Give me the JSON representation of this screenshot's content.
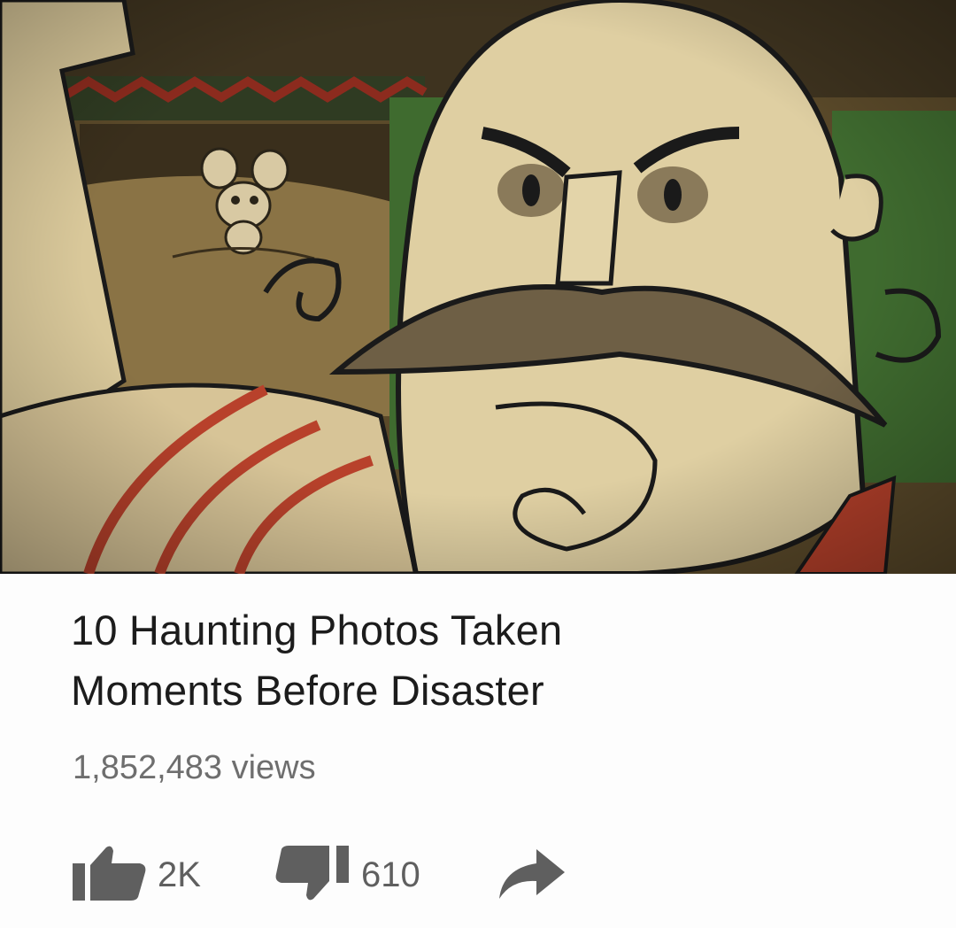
{
  "video": {
    "title_line1": "10 Haunting Photos Taken",
    "title_line2": "Moments Before Disaster",
    "views": "1,852,483 views"
  },
  "actions": {
    "like_icon": "thumbs-up-icon",
    "like_count": "2K",
    "dislike_icon": "thumbs-down-icon",
    "dislike_count": "610",
    "share_icon": "share-arrow-icon"
  },
  "colors": {
    "title": "#1c1c1c",
    "meta": "#6e6e6e",
    "icon": "#5f5f5f"
  }
}
